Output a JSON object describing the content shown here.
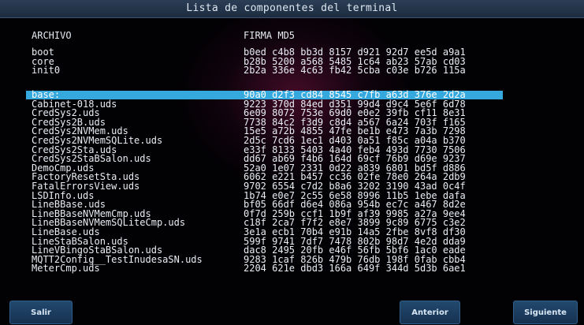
{
  "title": "Lista de componentes del terminal",
  "headers": {
    "file": "ARCHIVO",
    "md5": "FIRMA MD5"
  },
  "system_files": [
    {
      "name": "boot",
      "md5": "b0ed c4b8 bb3d 8157 d921 92d7 ee5d a9a1"
    },
    {
      "name": "core",
      "md5": "b28b 5200 a568 5485 1c64 ab23 57ab cd03"
    },
    {
      "name": "init0",
      "md5": "2b2a 336e 4c63 fb42 5cba c03e b726 115a"
    }
  ],
  "components": [
    {
      "name": "base:",
      "md5": "90a0 d2f3 cd84 8545 c7fb a63d 376e 2d2a",
      "selected": true
    },
    {
      "name": "Cabinet-018.uds",
      "md5": "9223 370d 84ed d351 99d4 d9c4 5e6f 6d78"
    },
    {
      "name": "CredSys2.uds",
      "md5": "6e09 8072 753e 69d0 e0e2 39fb cf11 8e31"
    },
    {
      "name": "CredSys2B.uds",
      "md5": "7738 84c2 f3d9 c8d4 a567 6a24 703f f165"
    },
    {
      "name": "CredSys2NVMem.uds",
      "md5": "15e5 a72b 4855 47fe be1b e473 7a3b 7298"
    },
    {
      "name": "CredSys2NVMemSQLite.uds",
      "md5": "2d5c 7cd6 1ec1 d403 0a51 f85c a04a b370"
    },
    {
      "name": "CredSys2Sta.uds",
      "md5": "e33f 8133 5403 4a40 feb4 493d 7730 7506"
    },
    {
      "name": "CredSys2StaBSalon.uds",
      "md5": "dd67 ab69 f4b6 164d 69cf 76b9 d69e 9237"
    },
    {
      "name": "DemoCmp.uds",
      "md5": "52a0 1e07 2331 0d22 a839 6801 bd5f d886"
    },
    {
      "name": "FactoryResetSta.uds",
      "md5": "6062 e221 b457 cc36 02fe 78e0 264a 2db9"
    },
    {
      "name": "FatalErrorsView.uds",
      "md5": "9702 6554 c7d2 b8a6 3202 3190 43ad 0c4f"
    },
    {
      "name": "LSDInfo.uds",
      "md5": "1b74 e0e7 2c55 6e58 8996 11b5 1ebe dafa"
    },
    {
      "name": "LineBBase.uds",
      "md5": "bf05 66df d6e4 086a 954b ec7c a467 8d2e"
    },
    {
      "name": "LineBBaseNVMemCmp.uds",
      "md5": "0f7d 259b ccf1 1b9f af39 9985 a27a 9ee4"
    },
    {
      "name": "LineBBaseNVMemSQLiteCmp.uds",
      "md5": "c18f 2ca7 f7f2 e8e7 3899 9c89 6775 c3e2"
    },
    {
      "name": "LineBase.uds",
      "md5": "3e1a ecb1 70b4 e91b 14a5 2fbe 8vf8 df30"
    },
    {
      "name": "LineStaBSalon.uds",
      "md5": "599f 9741 7df7 7478 802b 98d7 4e2d dda9"
    },
    {
      "name": "LineVBingoStaBSalon.uds",
      "md5": "dac8 2495 20fb e46f 56fb 5bf6 1ac0 eade"
    },
    {
      "name": "MQTT2Config__TestInudesaSN.uds",
      "md5": "9283 1caf 826b 479b 76db 198f 0fab cbb4"
    },
    {
      "name": "MeterCmp.uds",
      "md5": "2204 621e dbd3 166a 649f 344d 5d3b 6ae1"
    }
  ],
  "buttons": {
    "exit": "Salir",
    "previous": "Anterior",
    "next": "Siguiente"
  },
  "colors": {
    "selection": "#35a8dd",
    "button": "#1c3d5e",
    "titlebar": "#24364c"
  }
}
